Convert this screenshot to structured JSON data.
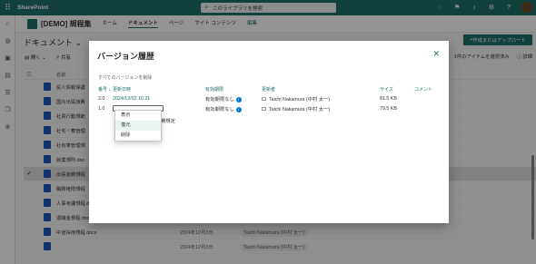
{
  "suite": {
    "app_name": "SharePoint",
    "search_placeholder": "このライブラリを検索"
  },
  "site": {
    "title": "[DEMO] 規程集",
    "nav": [
      "ホーム",
      "ドキュメント",
      "ページ",
      "サイト コンテンツ"
    ],
    "edit_label": "編集"
  },
  "library": {
    "title": "ドキュメント",
    "create_button": "作成またはアップロード",
    "cmd": {
      "open": "開く",
      "share": "共有",
      "edit_tail": "を編"
    },
    "selection_note": "1件のアイテムを選択済み",
    "details_label": "詳細",
    "columns": {
      "name": "名前"
    },
    "files": [
      {
        "name": "役人情報保護",
        "modified": "",
        "by": ""
      },
      {
        "name": "国内出張旅費",
        "modified": "",
        "by": ""
      },
      {
        "name": "社員行動規範",
        "modified": "",
        "by": ""
      },
      {
        "name": "社宅・寮管理",
        "modified": "",
        "by": ""
      },
      {
        "name": "社有車管理規",
        "modified": "",
        "by": ""
      },
      {
        "name": "就業規則.doc",
        "modified": "",
        "by": ""
      },
      {
        "name": "出張旅費規程",
        "modified": "",
        "by": ""
      },
      {
        "name": "職務権限規程",
        "modified": "",
        "by": ""
      },
      {
        "name": "人事考課規程.docx",
        "modified": "2024年12月3日",
        "by": "Taichi Nakamura (中村 太一)"
      },
      {
        "name": "退職金規程.docx",
        "modified": "2024年12月3日",
        "by": "Taichi Nakamura (中村 太一)"
      },
      {
        "name": "中途採用規程.docx",
        "modified": "2024年12月3日",
        "by": "Taichi Nakamura (中村 太一)"
      },
      {
        "name": "",
        "modified": "2024年12月3日",
        "by": "Taichi Nakamura (中村 太一)"
      }
    ]
  },
  "dialog": {
    "title": "バージョン履歴",
    "delete_all": "すべてのバージョンを削除",
    "columns": {
      "no": "番号",
      "date": "更新日時",
      "expiry": "有効期限",
      "by": "更新者",
      "size": "サイズ",
      "comment": "コメント"
    },
    "rows": [
      {
        "no": "2.0",
        "date": "2024/12/03 10:21",
        "expiry": "有効期限なし",
        "by": "Taichi Nakamura (中村 太一)",
        "size": "81.5 KB",
        "comment": ""
      },
      {
        "no": "1.0",
        "date": "",
        "expiry": "有効期限なし",
        "by": "Taichi Nakamura (中村 太一)",
        "size": "79.5 KB",
        "comment": ""
      }
    ],
    "leftover_text": "費規定",
    "context_menu": [
      "表示",
      "復元",
      "削除"
    ]
  },
  "colors": {
    "brand": "#1f6e6a",
    "info": "#0078d4"
  }
}
